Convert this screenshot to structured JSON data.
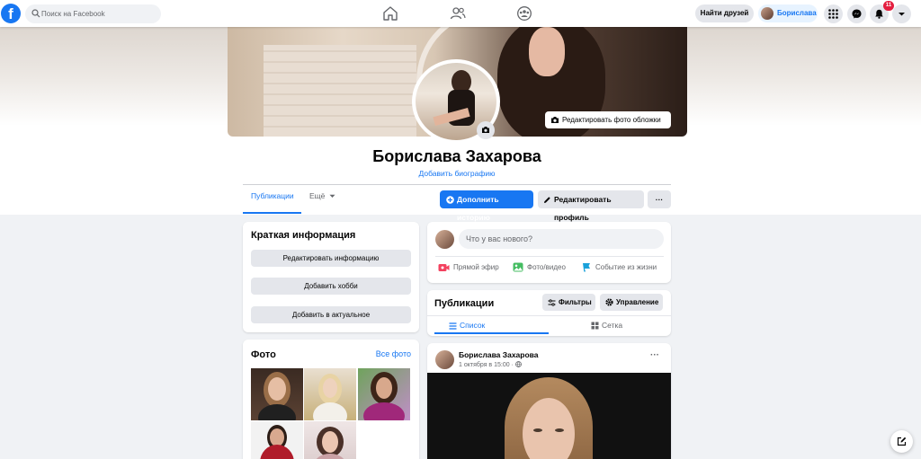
{
  "nav": {
    "search_placeholder": "Поиск на Facebook",
    "find_friends": "Найти друзей",
    "profile_name": "Борислава",
    "notifications_count": "11"
  },
  "cover": {
    "edit_cover_label": "Редактировать фото обложки"
  },
  "profile": {
    "name": "Борислава Захарова",
    "add_bio": "Добавить биографию"
  },
  "tabs": {
    "posts": "Публикации",
    "more": "Ещё"
  },
  "actions": {
    "add_story": "Дополнить историю",
    "edit_profile": "Редактировать профиль",
    "more": "···"
  },
  "intro": {
    "title": "Краткая информация",
    "edit_info": "Редактировать информацию",
    "add_hobby": "Добавить хобби",
    "add_featured": "Добавить в актуальное"
  },
  "photos": {
    "title": "Фото",
    "see_all": "Все фото"
  },
  "composer": {
    "placeholder": "Что у вас нового?",
    "live": "Прямой эфир",
    "photo_video": "Фото/видео",
    "life_event": "Событие из жизни"
  },
  "posts_header": {
    "title": "Публикации",
    "filters": "Фильтры",
    "manage": "Управление",
    "list_view": "Список",
    "grid_view": "Сетка"
  },
  "post": {
    "author": "Борислава Захарова",
    "date": "1 октября в 15:00 · ",
    "more": "···"
  },
  "colors": {
    "brand": "#1877f2",
    "background": "#f0f2f5",
    "badge": "#e41e3f"
  }
}
